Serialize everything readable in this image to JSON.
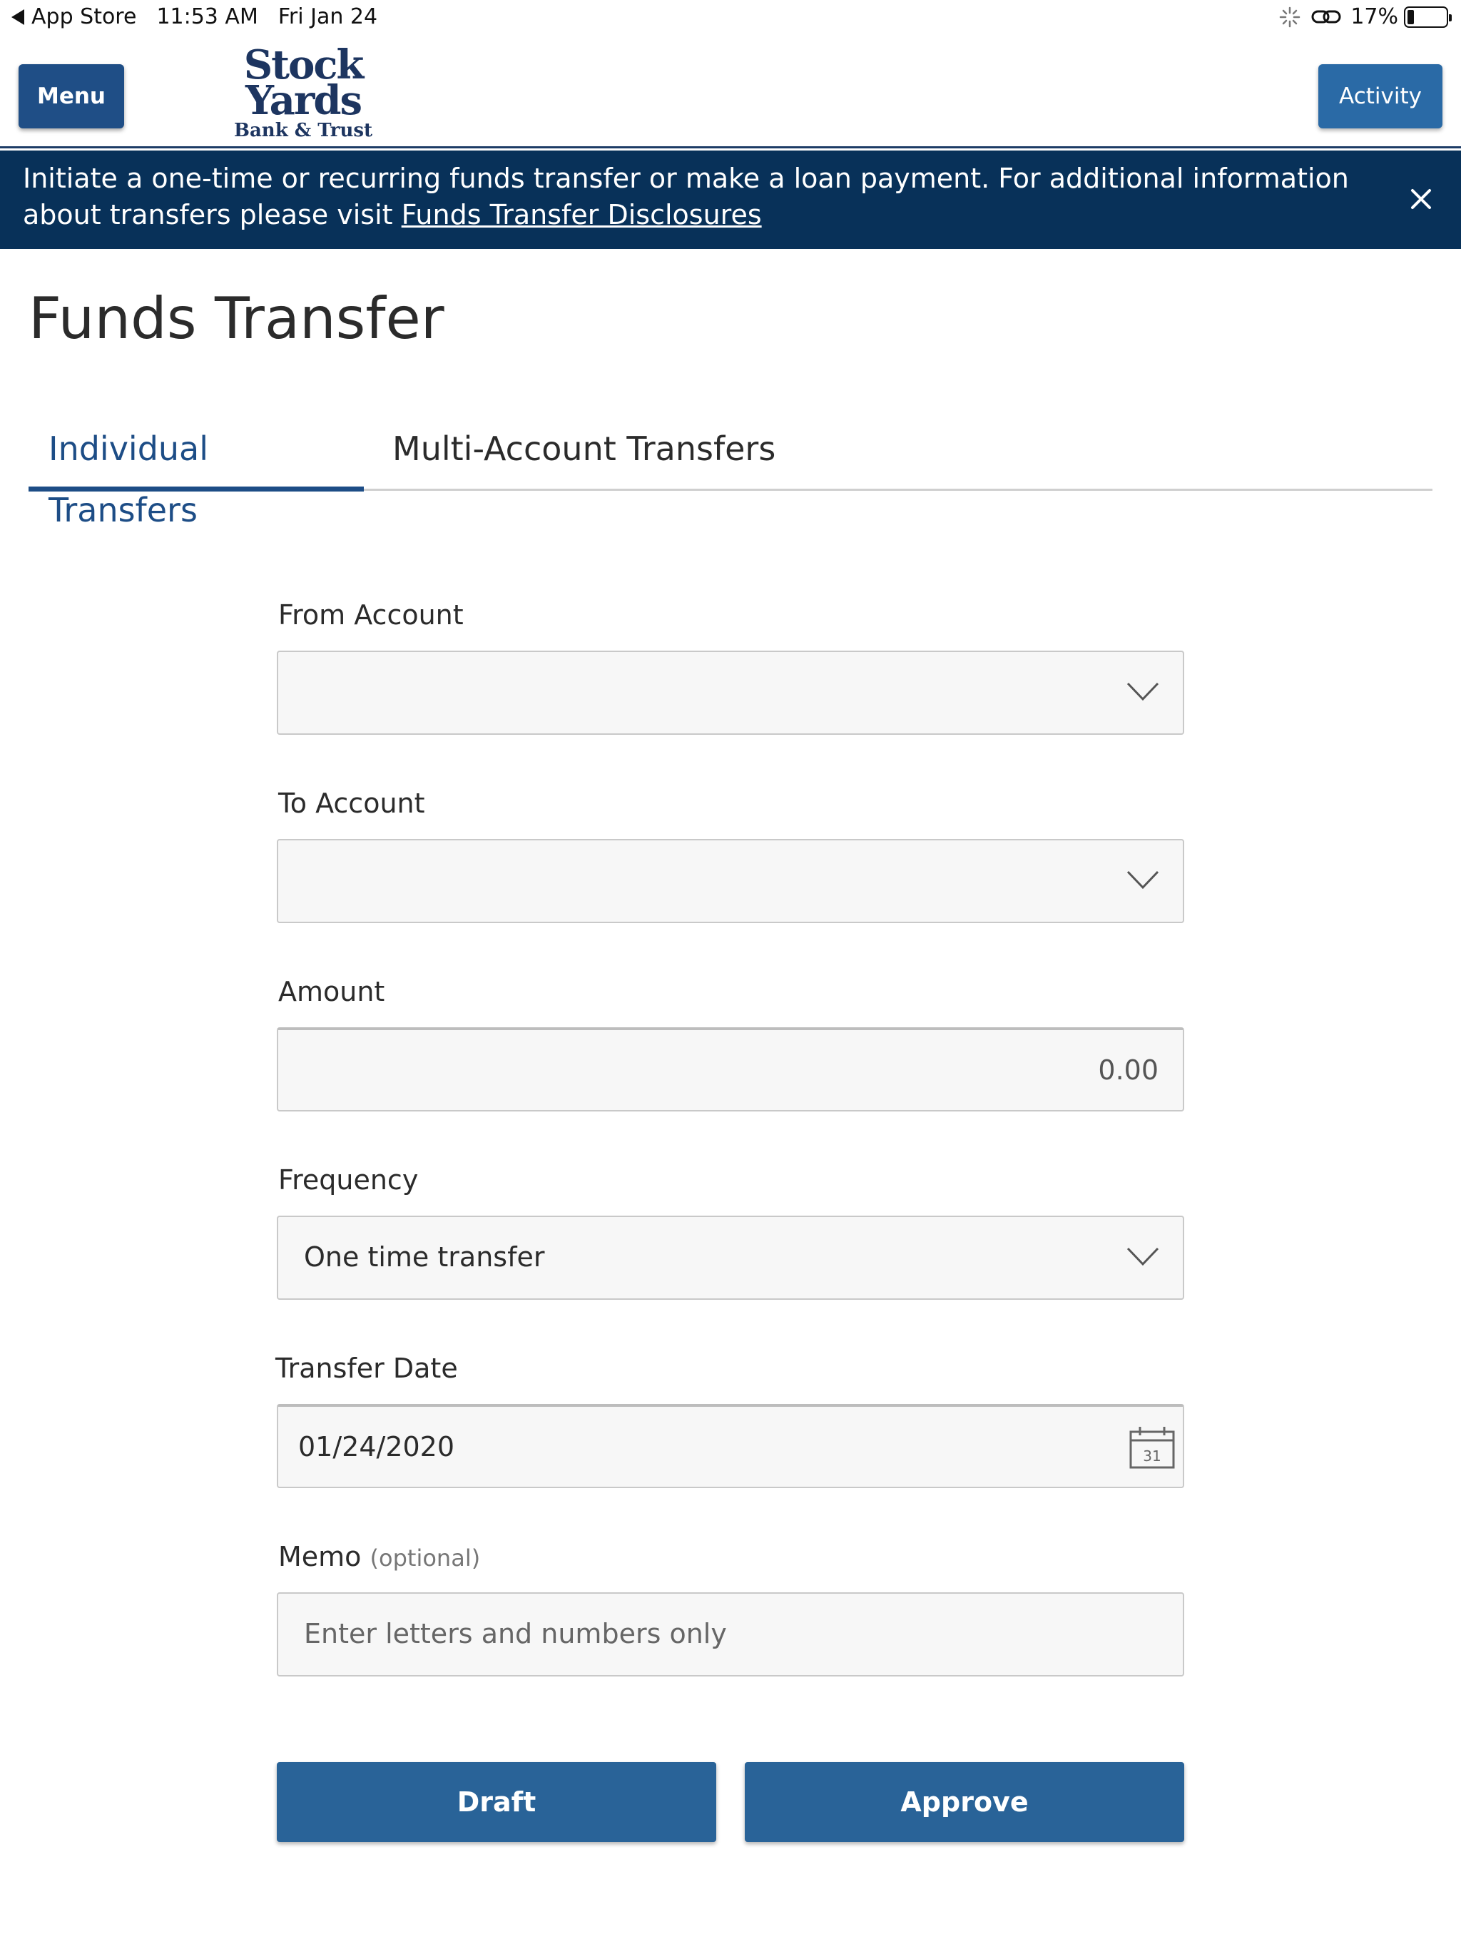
{
  "status_bar": {
    "back_app": "App Store",
    "time": "11:53 AM",
    "date": "Fri Jan 24",
    "battery": "17%",
    "battery_level": 0.17
  },
  "header": {
    "menu_label": "Menu",
    "activity_label": "Activity",
    "logo": {
      "line1": "Stock",
      "line2": "Yards",
      "line3": "Bank & Trust"
    }
  },
  "banner": {
    "text": "Initiate a one-time or recurring funds transfer or make a loan payment. For additional information about transfers please visit ",
    "link": "Funds Transfer Disclosures"
  },
  "page": {
    "title": "Funds Transfer",
    "tabs": [
      {
        "label": "Individual Transfers",
        "active": true
      },
      {
        "label": "Multi-Account Transfers",
        "active": false
      }
    ]
  },
  "form": {
    "from_account": {
      "label": "From Account",
      "value": ""
    },
    "to_account": {
      "label": "To Account",
      "value": ""
    },
    "amount": {
      "label": "Amount",
      "value": "0.00"
    },
    "frequency": {
      "label": "Frequency",
      "value": "One time transfer"
    },
    "transfer_date": {
      "label": "Transfer Date",
      "value": "01/24/2020",
      "calendar_day": "31"
    },
    "memo": {
      "label": "Memo",
      "optional": "(optional)",
      "placeholder": "Enter letters and numbers only"
    },
    "draft_label": "Draft",
    "approve_label": "Approve"
  }
}
